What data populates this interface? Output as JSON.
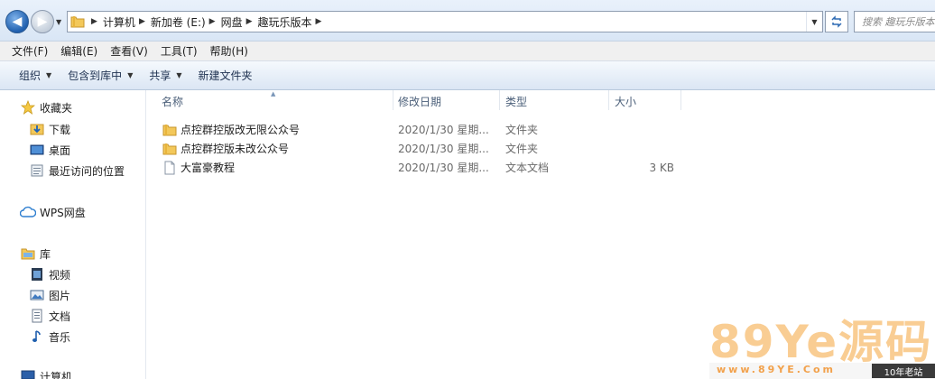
{
  "address": {
    "breadcrumbs": [
      "计算机",
      "新加卷 (E:)",
      "网盘",
      "趣玩乐版本"
    ],
    "search_placeholder": "搜索 趣玩乐版本"
  },
  "menu": [
    "文件(F)",
    "编辑(E)",
    "查看(V)",
    "工具(T)",
    "帮助(H)"
  ],
  "toolbar": {
    "organize": "组织",
    "include_library": "包含到库中",
    "share": "共享",
    "new_folder": "新建文件夹"
  },
  "nav": {
    "favorites": "收藏夹",
    "downloads": "下载",
    "desktop": "桌面",
    "recent": "最近访问的位置",
    "wps": "WPS网盘",
    "libraries": "库",
    "videos": "视频",
    "pictures": "图片",
    "documents": "文档",
    "music": "音乐",
    "computer": "计算机"
  },
  "columns": {
    "name": "名称",
    "date": "修改日期",
    "type": "类型",
    "size": "大小"
  },
  "files": [
    {
      "name": "点控群控版改无限公众号",
      "date": "2020/1/30 星期...",
      "type": "文件夹",
      "size": "",
      "icon": "folder-icon"
    },
    {
      "name": "点控群控版未改公众号",
      "date": "2020/1/30 星期...",
      "type": "文件夹",
      "size": "",
      "icon": "folder-icon"
    },
    {
      "name": "大富豪教程",
      "date": "2020/1/30 星期...",
      "type": "文本文档",
      "size": "3 KB",
      "icon": "text-file-icon"
    }
  ],
  "watermark": {
    "main": "89Ye源码",
    "url": "www.89YE.Com",
    "tag": "10年老站"
  }
}
